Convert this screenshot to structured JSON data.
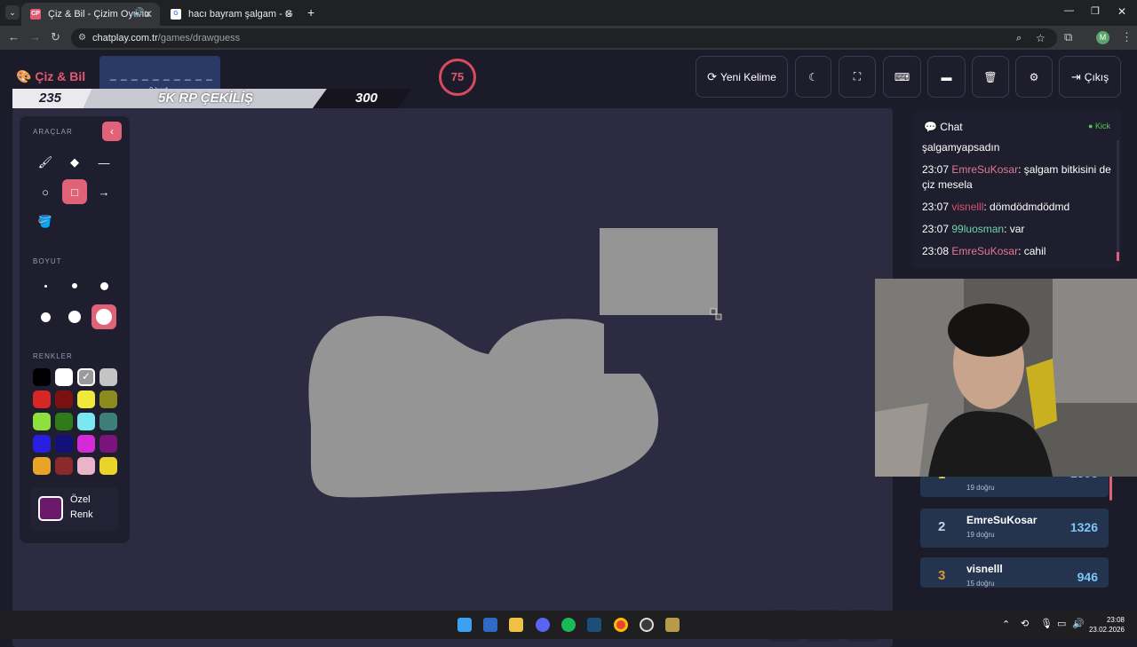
{
  "browser": {
    "tabs": [
      {
        "title": "Çiz & Bil - Çizim Oyunu",
        "favicon": "CP",
        "active": true
      },
      {
        "title": "hacı bayram şalgam - Google A",
        "favicon": "G",
        "active": false
      }
    ],
    "url_domain": "chatplay.com.tr",
    "url_path": "/games/drawguess",
    "profile_initial": "M"
  },
  "game": {
    "logo": "Çiz & Bil",
    "word_mask": "_ _ _ _ _ _ _ _ _ _",
    "word_hint": "9 harf",
    "timer": "75",
    "banner": {
      "left": "235",
      "center": "5K RP ÇEKİLİŞ",
      "right": "300"
    },
    "buttons": {
      "new_word": "Yeni Kelime",
      "exit": "Çıkış"
    },
    "icons": [
      "refresh-icon",
      "moon-icon",
      "fullscreen-icon",
      "keyboard-icon",
      "archive-icon",
      "trash-icon",
      "gear-icon",
      "sign-out-icon"
    ]
  },
  "tools": {
    "section_tools": "ARAÇLAR",
    "section_size": "BOYUT",
    "section_colors": "RENKLER",
    "active_tool": "rectangle",
    "active_size_index": 5,
    "selected_color": "#9a9a9a",
    "colors": [
      "#000000",
      "#ffffff",
      "#9a9a9a",
      "#c4c4c4",
      "#d62626",
      "#7a1212",
      "#f0e83a",
      "#8a8a1e",
      "#8ee03c",
      "#2f7a1a",
      "#7ae8f0",
      "#3e7e78",
      "#2a1ee0",
      "#14107a",
      "#d42ad8",
      "#7a147a",
      "#e8a428",
      "#8a2a2a",
      "#e8b4c8",
      "#e8d42a"
    ],
    "custom_label": "Özel Renk",
    "custom_color": "#6b1a6b",
    "brush_color": "#969696"
  },
  "chat": {
    "title": "Chat",
    "platform": "Kick",
    "messages": [
      {
        "time": "",
        "user": "",
        "text": "şalgamyapsadın",
        "color": "u1"
      },
      {
        "time": "23:07",
        "user": "EmreSuKosar",
        "text": ": şalgam bitkisini de çiz mesela",
        "color": "u1"
      },
      {
        "time": "23:07",
        "user": "visnelll",
        "text": ": dömdödmdödmd",
        "color": "u2"
      },
      {
        "time": "23:07",
        "user": "99luosman",
        "text": ": var",
        "color": "u3"
      },
      {
        "time": "23:08",
        "user": "EmreSuKosar",
        "text": ": cahil",
        "color": "u1"
      }
    ]
  },
  "leaderboard": [
    {
      "rank": "1",
      "name": "",
      "sub": "19 doğru",
      "points": "1503",
      "rank_color": "#f0d24a"
    },
    {
      "rank": "2",
      "name": "EmreSuKosar",
      "sub": "19 doğru",
      "points": "1326",
      "rank_color": "#c8d0e0"
    },
    {
      "rank": "3",
      "name": "visnelll",
      "sub": "15 doğru",
      "points": "946",
      "rank_color": "#e0903a"
    }
  ],
  "taskbar": {
    "time": "23:08",
    "date": "23.02.2026"
  }
}
